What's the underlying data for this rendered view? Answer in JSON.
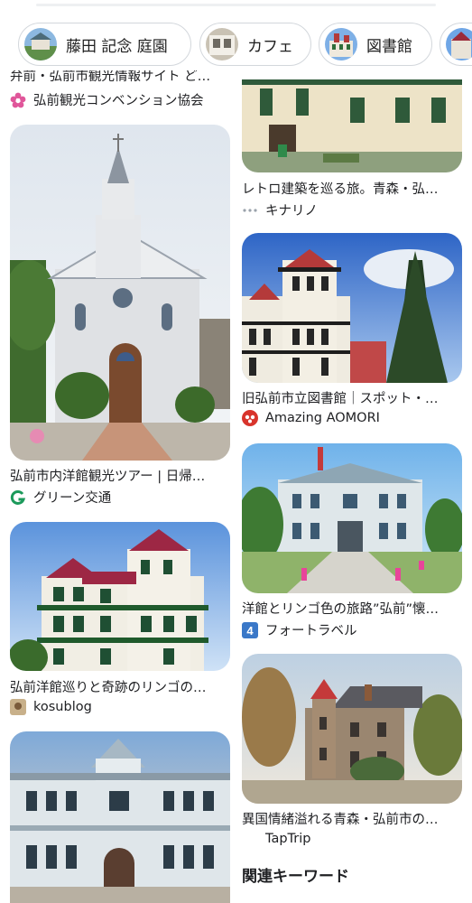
{
  "chips": [
    {
      "label": "藤田 記念 庭園",
      "thumb": "garden-thumb-icon"
    },
    {
      "label": "カフェ",
      "thumb": "cafe-thumb-icon"
    },
    {
      "label": "図書館",
      "thumb": "library-thumb-icon"
    },
    {
      "label": "",
      "thumb": "more-thumb-icon"
    }
  ],
  "left_column": [
    {
      "title": "弁前・弘前市観光情報サイト ど…",
      "source": "弘前観光コンベンション協会",
      "source_icon": "flower-logo-icon"
    },
    {
      "title": "弘前市内洋館観光ツアー | 日帰…",
      "source": "グリーン交通",
      "source_icon": "g-logo-icon"
    },
    {
      "title": "弘前洋館巡りと奇跡のリンゴの…",
      "source": "kosublog",
      "source_icon": "kosublog-logo-icon"
    },
    {
      "title": "",
      "source": "",
      "source_icon": "none"
    }
  ],
  "right_column": [
    {
      "title": "",
      "source": "",
      "source_icon": "none"
    },
    {
      "title": "レトロ建築を巡る旅。青森・弘…",
      "source": "キナリノ",
      "source_icon": "dots-logo-icon"
    },
    {
      "title": "旧弘前市立図書館｜スポット・…",
      "source": "Amazing AOMORI",
      "source_icon": "amazing-logo-icon"
    },
    {
      "title": "洋館とリンゴ色の旅路”弘前”懐…",
      "source": "フォートラベル",
      "source_icon": "four-logo-icon"
    },
    {
      "title": "異国情緒溢れる青森・弘前市の…",
      "source": "TapTrip",
      "source_icon": "none"
    }
  ],
  "related_keywords_heading": "関連キーワード",
  "colors": {
    "chip_border": "#d3d7dc",
    "text": "#202124",
    "sky": "#6fa6e6"
  }
}
